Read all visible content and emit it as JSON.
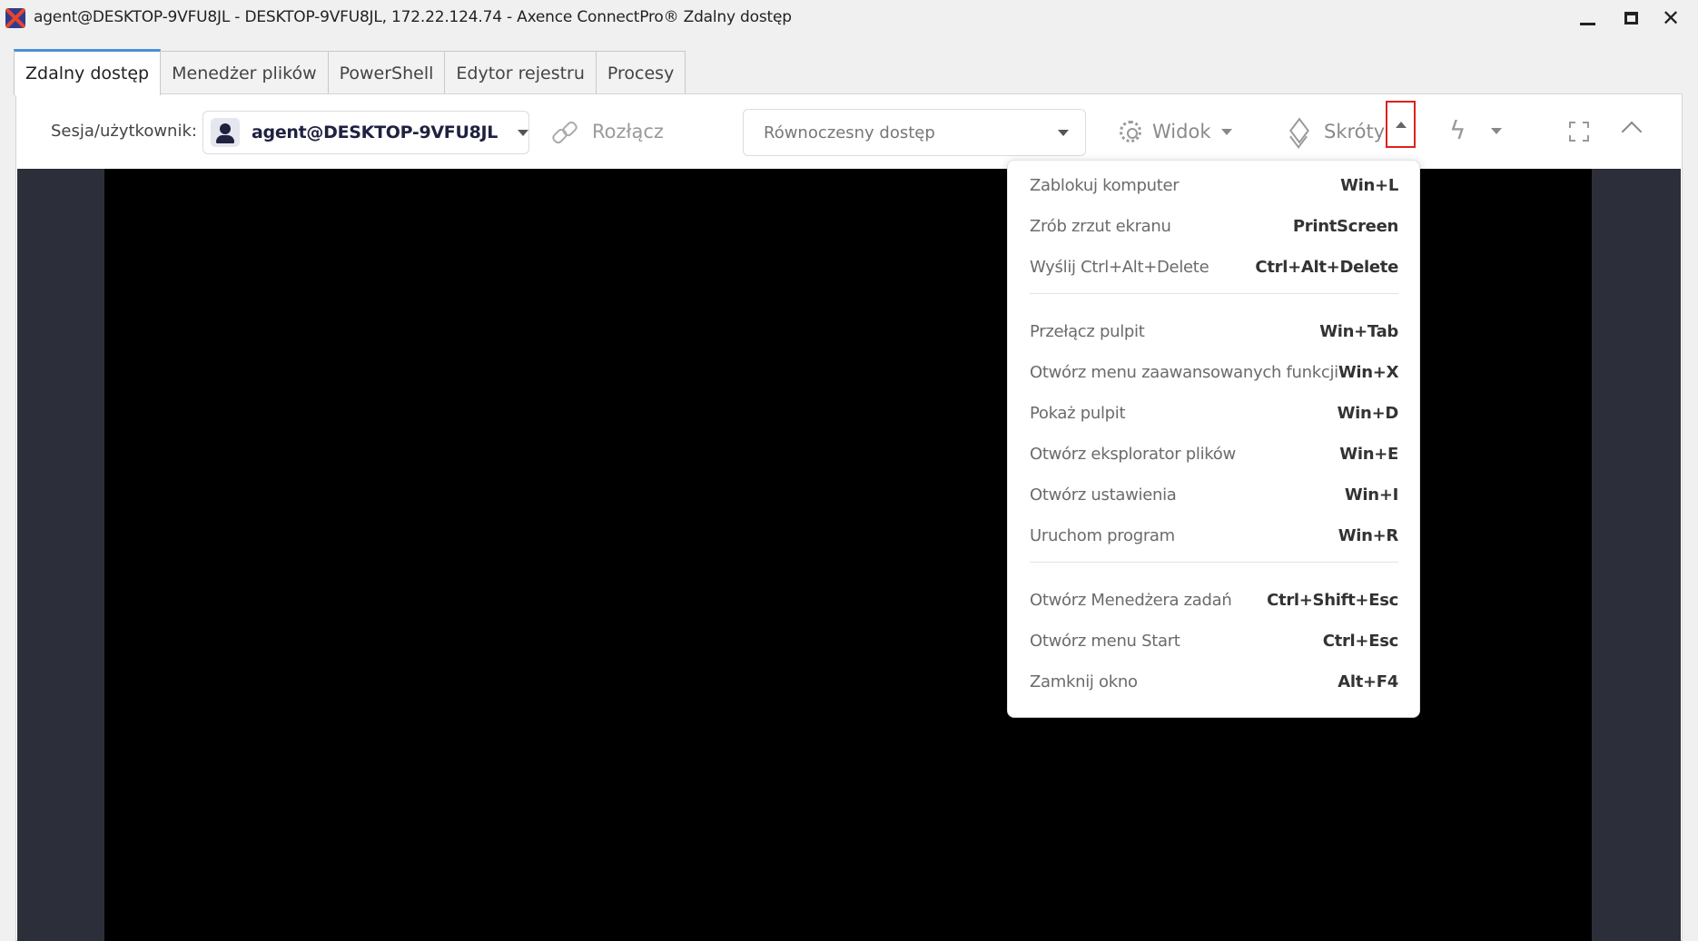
{
  "window": {
    "title": "agent@DESKTOP-9VFU8JL - DESKTOP-9VFU8JL, 172.22.124.74 - Axence ConnectPro® Zdalny dostęp",
    "minimize_glyph": "",
    "close_glyph": "✕"
  },
  "tabs": [
    {
      "label": "Zdalny dostęp",
      "active": true
    },
    {
      "label": "Menedżer plików",
      "active": false
    },
    {
      "label": "PowerShell",
      "active": false
    },
    {
      "label": "Edytor rejestru",
      "active": false
    },
    {
      "label": "Procesy",
      "active": false
    }
  ],
  "toolbar": {
    "session_label": "Sesja/użytkownik:",
    "session_value": "agent@DESKTOP-9VFU8JL",
    "disconnect_label": "Rozłącz",
    "access_mode_value": "Równoczesny dostęp",
    "view_label": "Widok",
    "shortcuts_label": "Skróty",
    "bolt_glyph": "ϟ"
  },
  "shortcuts_menu": {
    "groups": [
      [
        {
          "label": "Zablokuj komputer",
          "key": "Win+L"
        },
        {
          "label": "Zrób zrzut ekranu",
          "key": "PrintScreen"
        },
        {
          "label": "Wyślij Ctrl+Alt+Delete",
          "key": "Ctrl+Alt+Delete"
        }
      ],
      [
        {
          "label": "Przełącz pulpit",
          "key": "Win+Tab"
        },
        {
          "label": "Otwórz menu zaawansowanych funkcji",
          "key": "Win+X"
        },
        {
          "label": "Pokaż pulpit",
          "key": "Win+D"
        },
        {
          "label": "Otwórz eksplorator plików",
          "key": "Win+E"
        },
        {
          "label": "Otwórz ustawienia",
          "key": "Win+I"
        },
        {
          "label": "Uruchom program",
          "key": "Win+R"
        }
      ],
      [
        {
          "label": "Otwórz Menedżera zadań",
          "key": "Ctrl+Shift+Esc"
        },
        {
          "label": "Otwórz menu Start",
          "key": "Ctrl+Esc"
        },
        {
          "label": "Zamknij okno",
          "key": "Alt+F4"
        }
      ]
    ]
  },
  "colors": {
    "accent": "#4a8fd6",
    "highlight_box": "#e0201b",
    "remote_background": "#2c2f3a",
    "remote_screen": "#000000"
  }
}
